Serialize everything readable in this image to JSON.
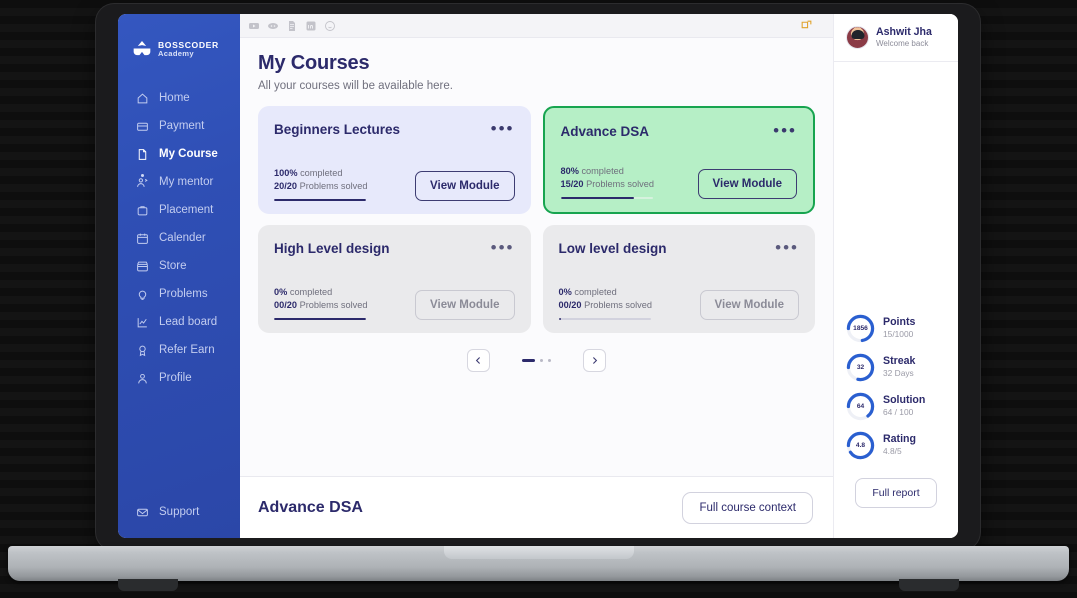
{
  "brand": {
    "name_line1": "BOSSCODER",
    "name_line2": "Academy",
    "logo_icon": "bosscoder-mask-icon"
  },
  "colors": {
    "sidebar": "#2f4fb5",
    "primary_text": "#2c2a6b",
    "accent_green": "#17a44f",
    "card_lavender": "#e7e9fb",
    "card_green": "#b6efc6",
    "card_grey": "#eaeaec",
    "ring_blue": "#2a5fd0"
  },
  "sidebar": {
    "items": [
      {
        "label": "Home",
        "icon": "home-icon",
        "active": false
      },
      {
        "label": "Payment",
        "icon": "card-icon",
        "active": false
      },
      {
        "label": "My Course",
        "icon": "document-icon",
        "active": true
      },
      {
        "label": "My mentor",
        "icon": "mentor-icon",
        "active": false
      },
      {
        "label": "Placement",
        "icon": "briefcase-icon",
        "active": false
      },
      {
        "label": "Calender",
        "icon": "calendar-icon",
        "active": false
      },
      {
        "label": "Store",
        "icon": "store-icon",
        "active": false
      },
      {
        "label": "Problems",
        "icon": "lightbulb-icon",
        "active": false
      },
      {
        "label": "Lead board",
        "icon": "chart-icon",
        "active": false
      },
      {
        "label": "Refer Earn",
        "icon": "medal-icon",
        "active": false
      },
      {
        "label": "Profile",
        "icon": "person-icon",
        "active": false
      }
    ],
    "support": {
      "label": "Support",
      "icon": "mail-icon"
    }
  },
  "topbar": {
    "social_icons": [
      "youtube-icon",
      "discord-icon",
      "doc-icon",
      "linkedin-icon",
      "smiley-icon"
    ],
    "right_icon": "notification-icon"
  },
  "main": {
    "title": "My Courses",
    "subtitle": "All your courses will be available here.",
    "cards": [
      {
        "title": "Beginners Lectures",
        "percent_label": "100%",
        "percent_word": "completed",
        "solved_label": "20/20",
        "solved_word": "Problems solved",
        "progress": 100,
        "button": "View Module",
        "menu_icon": "more-dots-icon",
        "theme": "lavender",
        "button_style": "dark"
      },
      {
        "title": "Advance DSA",
        "percent_label": "80%",
        "percent_word": "completed",
        "solved_label": "15/20",
        "solved_word": "Problems solved",
        "progress": 80,
        "button": "View Module",
        "menu_icon": "more-dots-icon",
        "theme": "green",
        "button_style": "dark"
      },
      {
        "title": "High Level design",
        "percent_label": "0%",
        "percent_word": "completed",
        "solved_label": "00/20",
        "solved_word": "Problems solved",
        "progress": 100,
        "button": "View Module",
        "menu_icon": "more-dots-icon",
        "theme": "grey",
        "button_style": "light"
      },
      {
        "title": "Low level design",
        "percent_label": "0%",
        "percent_word": "completed",
        "solved_label": "00/20",
        "solved_word": "Problems solved",
        "progress": 3,
        "button": "View Module",
        "menu_icon": "more-dots-icon",
        "theme": "grey",
        "button_style": "light"
      }
    ],
    "pager": {
      "prev_icon": "chevron-left-icon",
      "next_icon": "chevron-right-icon",
      "indicator": {
        "active_index": 0,
        "count": 3
      }
    },
    "bottom": {
      "title": "Advance DSA",
      "button": "Full course context"
    }
  },
  "rail": {
    "profile": {
      "name": "Ashwit Jha",
      "greeting": "Welcome back",
      "avatar_icon": "user-avatar"
    },
    "stats": [
      {
        "label": "Points",
        "value": "1856",
        "sub": "15/1000",
        "progress": 72
      },
      {
        "label": "Streak",
        "value": "32",
        "sub": "32 Days",
        "progress": 78
      },
      {
        "label": "Solution",
        "value": "64",
        "sub": "64 / 100",
        "progress": 64
      },
      {
        "label": "Rating",
        "value": "4.8",
        "sub": "4.8/5",
        "progress": 90
      }
    ],
    "full_report_button": "Full report"
  }
}
